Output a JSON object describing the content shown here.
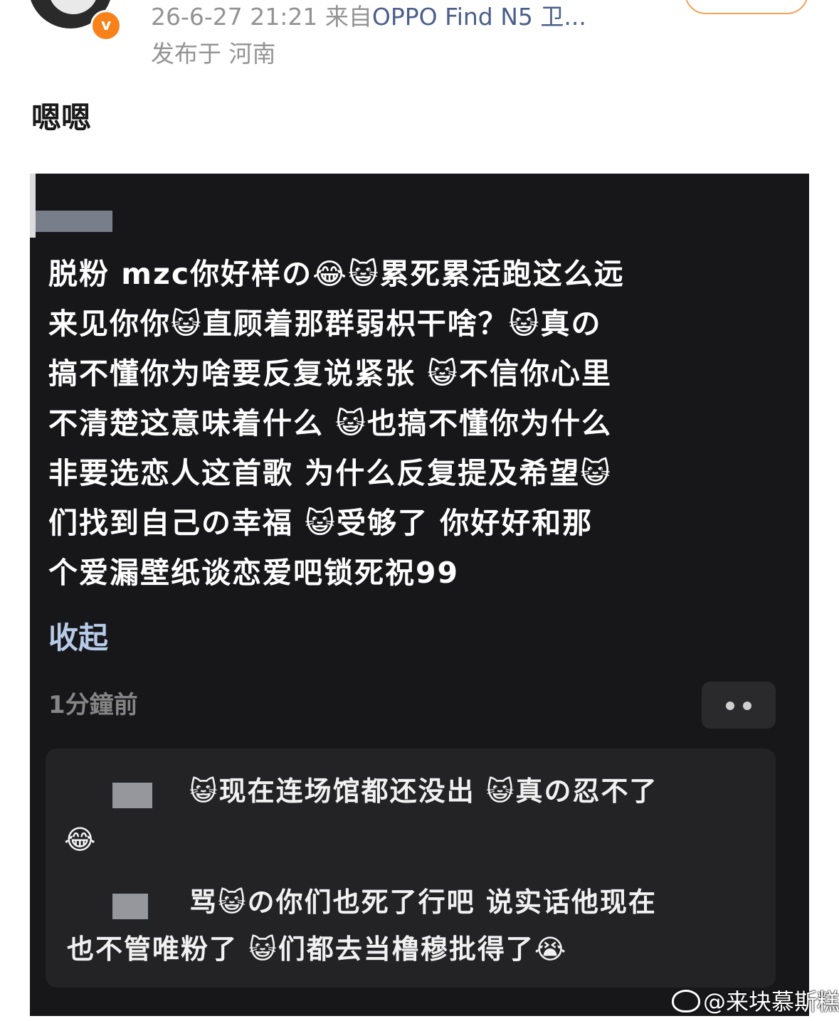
{
  "post": {
    "timestamp": "26-6-27 21:21",
    "source_prefix": "来自",
    "device": "OPPO Find N5 卫...",
    "location": "发布于 河南",
    "text": "嗯嗯",
    "badge": "v"
  },
  "screenshot": {
    "comment_lines": [
      "脱粉 mzc你好样の😂😺累死累活跑这么远",
      "来见你你😺直顾着那群弱枳干啥？😺真の",
      "搞不懂你为啥要反复说紧张 😺不信你心里",
      "不清楚这意味着什么 😺也搞不懂你为什么",
      "非要选恋人这首歌 为什么反复提及希望😺",
      "们找到自己の幸福 😺受够了 你好好和那",
      "个爱漏壁纸谈恋爱吧锁死祝99"
    ],
    "collapse_label": "收起",
    "time_ago": "1分鐘前",
    "replies": [
      {
        "line1": "😺现在连场馆都还没出 😺真の忍不了",
        "line2": "😂"
      },
      {
        "line1": "骂😺の你们也死了行吧 说实话他现在",
        "line2": "也不管唯粉了 😺们都去当橹穆批得了😭"
      }
    ]
  },
  "watermark": "@来块慕斯糕"
}
